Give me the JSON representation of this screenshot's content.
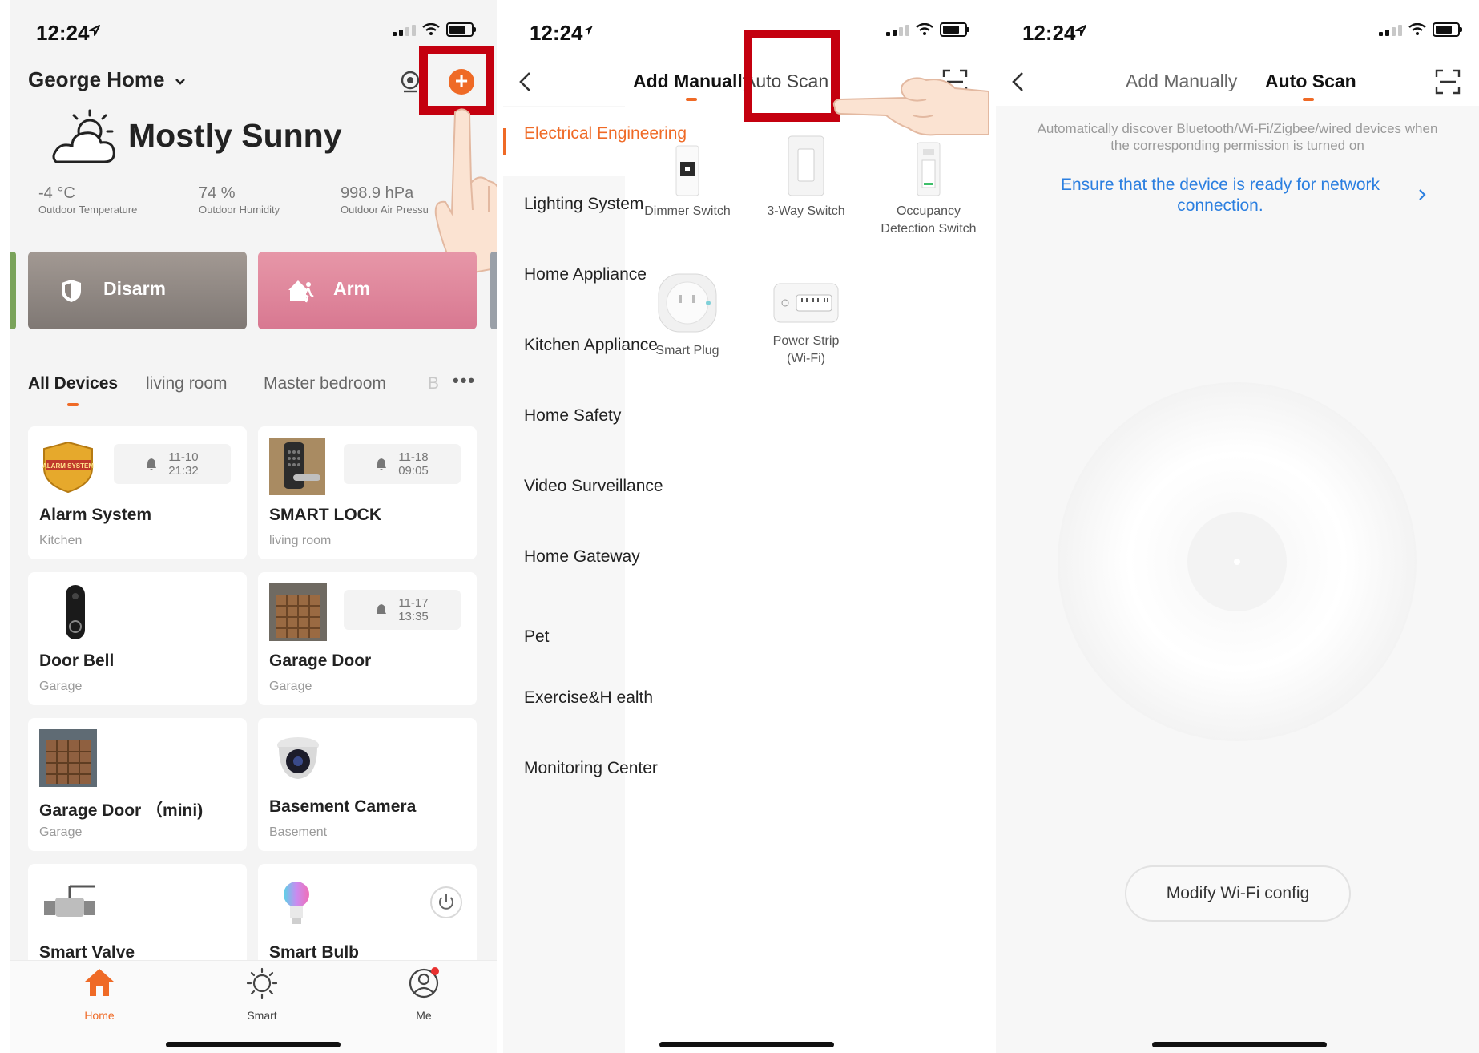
{
  "status_bar": {
    "time": "12:24"
  },
  "screen1": {
    "home_name": "George Home",
    "weather": {
      "condition": "Mostly Sunny"
    },
    "stats": [
      {
        "value": "-4 °C",
        "label": "Outdoor Temperature"
      },
      {
        "value": "74 %",
        "label": "Outdoor Humidity"
      },
      {
        "value": "998.9 hPa",
        "label": "Outdoor Air Pressu"
      }
    ],
    "security": {
      "disarm": "Disarm",
      "arm": "Arm"
    },
    "tabs": [
      "All Devices",
      "living room",
      "Master bedroom",
      "B"
    ],
    "devices": [
      {
        "name": "Alarm System",
        "room": "Kitchen",
        "alert": [
          "11-10",
          "21:32"
        ]
      },
      {
        "name": "SMART LOCK",
        "room": "living room",
        "alert": [
          "11-18",
          "09:05"
        ]
      },
      {
        "name": "Door Bell",
        "room": "Garage"
      },
      {
        "name": "Garage Door",
        "room": "Garage",
        "alert": [
          "11-17",
          "13:35"
        ]
      },
      {
        "name": "Garage Door （mini)",
        "room": "Garage"
      },
      {
        "name": "Basement Camera",
        "room": "Basement"
      },
      {
        "name": "Smart Valve"
      },
      {
        "name": "Smart Bulb"
      }
    ],
    "alarm_logo_text": "ALARM SYSTEM",
    "bottom_nav": [
      "Home",
      "Smart",
      "Me"
    ],
    "colors": {
      "accent": "#ef6a26",
      "highlight_box": "#c4000f",
      "disarm_bg": "#8d8580",
      "arm_bg": "#e0869a"
    }
  },
  "screen2": {
    "tabs": {
      "manual": "Add Manually",
      "auto": "Auto Scan"
    },
    "categories": [
      "Electrical Engineering",
      "Lighting System",
      "Home Appliance",
      "Kitchen Appliance",
      "Home Safety",
      "Video Surveillance",
      "Home Gateway",
      "Pet",
      "Exercise&H ealth",
      "Monitoring Center"
    ],
    "products": [
      "Dimmer Switch",
      "3-Way Switch",
      "Occupancy Detection Switch",
      "Smart Plug",
      "Power Strip (Wi-Fi)"
    ]
  },
  "screen3": {
    "tabs": {
      "manual": "Add Manually",
      "auto": "Auto Scan"
    },
    "hint": "Automatically discover Bluetooth/Wi-Fi/Zigbee/wired devices when the corresponding permission is turned on",
    "link": "Ensure that the device is ready for network connection.",
    "button": "Modify Wi-Fi config",
    "colors": {
      "link": "#2b7fe0"
    }
  }
}
